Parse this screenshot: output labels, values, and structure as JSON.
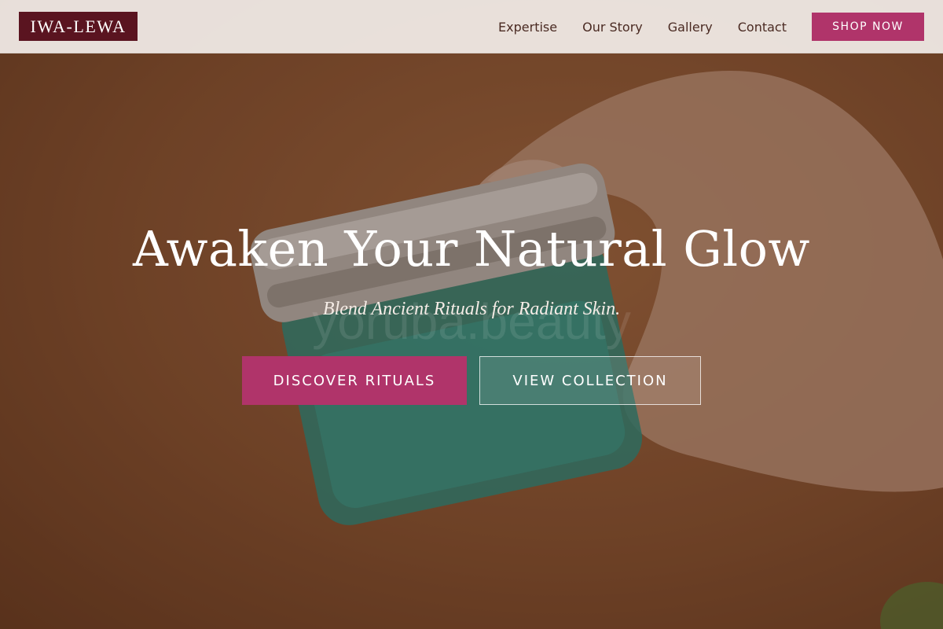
{
  "brand": {
    "logo_text": "IWA-LEWA"
  },
  "nav": {
    "links": [
      {
        "label": "Expertise"
      },
      {
        "label": "Our Story"
      },
      {
        "label": "Gallery"
      },
      {
        "label": "Contact"
      }
    ],
    "shop_label": "SHOP NOW"
  },
  "hero": {
    "title": "Awaken Your Natural Glow",
    "subtitle": "Blend Ancient Rituals for Radiant Skin.",
    "watermark": "yoruba.beauty",
    "primary_cta": "DISCOVER RITUALS",
    "secondary_cta": "VIEW COLLECTION"
  },
  "colors": {
    "accent": "#b0346a",
    "logo_bg": "#5a1420",
    "nav_text": "#4a2a22",
    "hero_bg": "#8c5533"
  }
}
